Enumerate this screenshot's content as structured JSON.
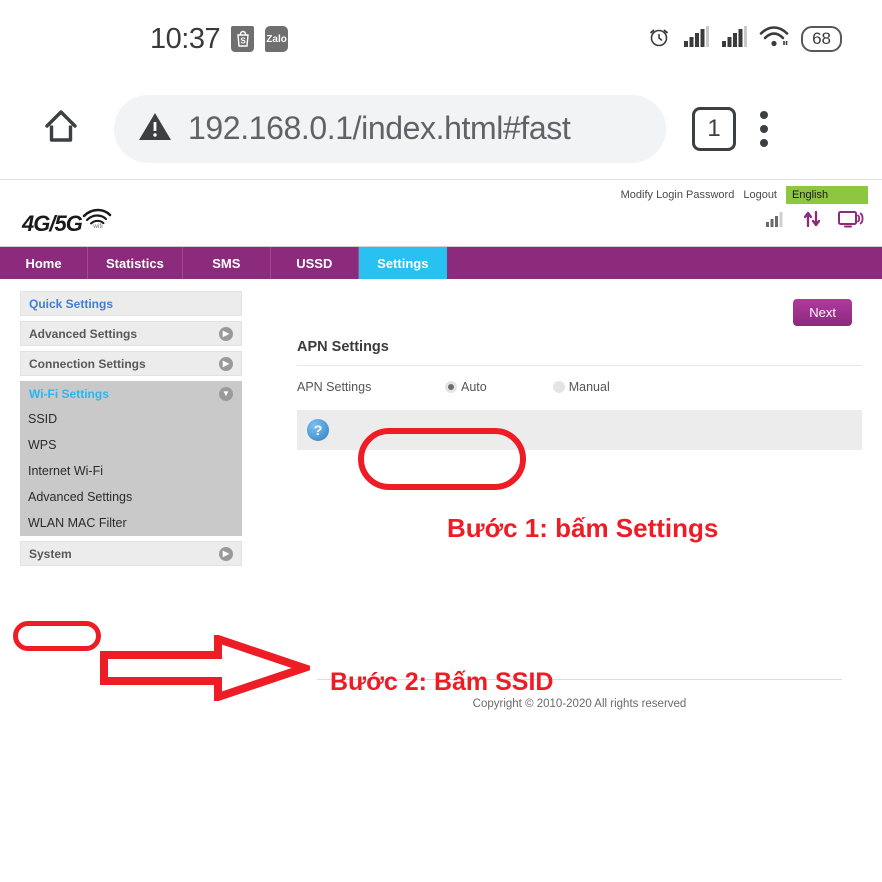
{
  "phone_status_bar": {
    "clock": "10:37",
    "app_icons": [
      {
        "name": "shopee-icon",
        "label": "S"
      },
      {
        "name": "zalo-icon",
        "label": "Zalo"
      }
    ],
    "right_icons": [
      "alarm-clock-icon",
      "signal-bars-sim1-icon",
      "signal-bars-sim2-icon",
      "wifi-icon"
    ],
    "battery_level": "68"
  },
  "browser": {
    "home_icon": "home-icon",
    "security_icon": "warning-triangle-icon",
    "url": "192.168.0.1/index.html#fast",
    "tab_count": "1",
    "menu_icon": "overflow-menu-icon"
  },
  "router": {
    "logo": {
      "text": "4G/5G",
      "sub": "wifi",
      "icon": "wifi-signal-icon"
    },
    "top_links": {
      "modify_password": "Modify Login Password",
      "logout": "Logout",
      "language": "English",
      "language_bg": "#8dc63f"
    },
    "top_icons": [
      {
        "name": "signal-strength-icon"
      },
      {
        "name": "data-transfer-icon"
      },
      {
        "name": "connected-devices-icon"
      }
    ],
    "nav": {
      "items": [
        {
          "label": "Home",
          "active": false
        },
        {
          "label": "Statistics",
          "active": false
        },
        {
          "label": "SMS",
          "active": false
        },
        {
          "label": "USSD",
          "active": false
        },
        {
          "label": "Settings",
          "active": true
        }
      ],
      "bar_color": "#8c2a7b",
      "active_color": "#29c0f2"
    },
    "sidebar": {
      "quick_settings": "Quick Settings",
      "advanced_settings": "Advanced Settings",
      "connection_settings": "Connection Settings",
      "wifi_settings": "Wi-Fi Settings",
      "system": "System",
      "wifi_children": [
        "SSID",
        "WPS",
        "Internet Wi-Fi",
        "Advanced Settings",
        "WLAN MAC Filter"
      ]
    },
    "main": {
      "next_button": "Next",
      "section_title": "APN Settings",
      "field_label": "APN Settings",
      "options": [
        {
          "label": "Auto",
          "selected": true
        },
        {
          "label": "Manual",
          "selected": false
        }
      ],
      "help_icon": "help-question-icon"
    },
    "footer": "Copyright © 2010-2020 All rights reserved"
  },
  "annotations": {
    "color": "#ee1c25",
    "step1": "Bước 1: bấm Settings",
    "step2": "Bước 2: Bấm SSID",
    "highlight_settings_tab": "oval-around-settings-tab",
    "highlight_ssid_item": "oval-around-ssid-item",
    "arrow": "right-pointing-arrow"
  }
}
